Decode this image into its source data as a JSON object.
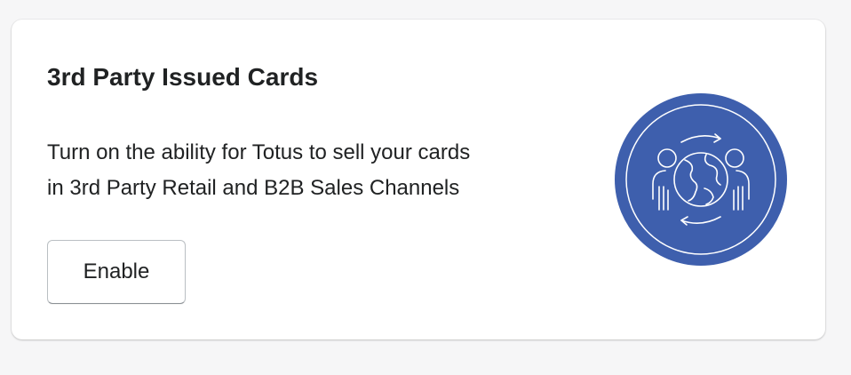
{
  "card": {
    "title": "3rd Party Issued Cards",
    "description_line1": "Turn on the ability for Totus to sell your cards",
    "description_line2": "in 3rd Party Retail and B2B Sales Channels",
    "enable_label": "Enable",
    "illustration_icon": "globe-with-people-exchange-icon"
  },
  "colors": {
    "background": "#f6f6f7",
    "card": "#ffffff",
    "text": "#202223",
    "illustration_fill": "#3e5fad"
  }
}
